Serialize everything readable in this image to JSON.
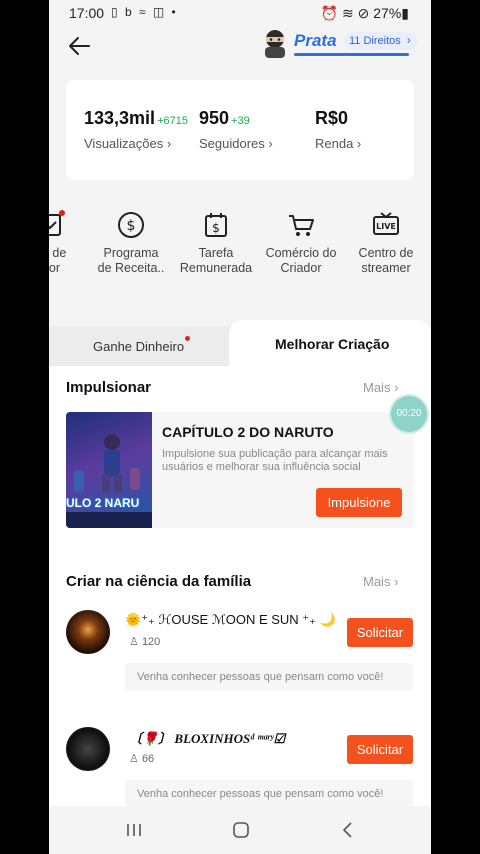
{
  "status": {
    "time": "17:00",
    "icons_left": "▯ b ≈ ◫ •",
    "icons_right": "⏰ ≋ ⊘ 27%▮"
  },
  "header": {
    "tier": "Prata",
    "rights": "11 Direitos"
  },
  "stats": [
    {
      "value": "133,3mil",
      "delta": "+6715",
      "label": "Visualizações ›"
    },
    {
      "value": "950",
      "delta": "+39",
      "label": "Seguidores ›"
    },
    {
      "value": "R$0",
      "delta": "",
      "label": "Renda ›"
    }
  ],
  "tools": [
    {
      "label1": "as de",
      "label2": "dor",
      "icon": "badge-icon"
    },
    {
      "label1": "Programa",
      "label2": "de Receita..",
      "icon": "dollar-circle-icon"
    },
    {
      "label1": "Tarefa",
      "label2": "Remunerada",
      "icon": "dollar-calendar-icon"
    },
    {
      "label1": "Comércio do",
      "label2": "Criador",
      "icon": "cart-icon"
    },
    {
      "label1": "Centro de",
      "label2": "streamer",
      "icon": "live-tv-icon"
    }
  ],
  "tabs": {
    "earn": "Ganhe Dinheiro",
    "improve": "Melhorar Criação"
  },
  "boost_section": {
    "title": "Impulsionar",
    "more": "Mais",
    "card_title": "CAPÍTULO 2 DO NARUTO",
    "card_desc": "Impulsione sua publicação para alcançar mais usuários e melhorar sua influência social",
    "button": "Impulsione",
    "thumb_text": "ULO 2 NARU"
  },
  "timer": "00:20",
  "family_section": {
    "title": "Criar na ciência da família",
    "more": "Mais",
    "families": [
      {
        "name": "🌞⁺₊ ℋOUSE ℳOON E SUN ⁺₊ 🌙",
        "count": "120",
        "button": "Solicitar",
        "message": "Venha conhecer pessoas que pensam como você!"
      },
      {
        "name": "〔🌹〕 BLOXINHOSᵈ ᵐᵃʳʸ☑",
        "count": "66",
        "button": "Solicitar",
        "message": "Venha conhecer pessoas que pensam como você!"
      }
    ]
  },
  "colors": {
    "accent": "#f4511e",
    "tier_blue": "#2e6fe0",
    "positive": "#1aaa55"
  }
}
